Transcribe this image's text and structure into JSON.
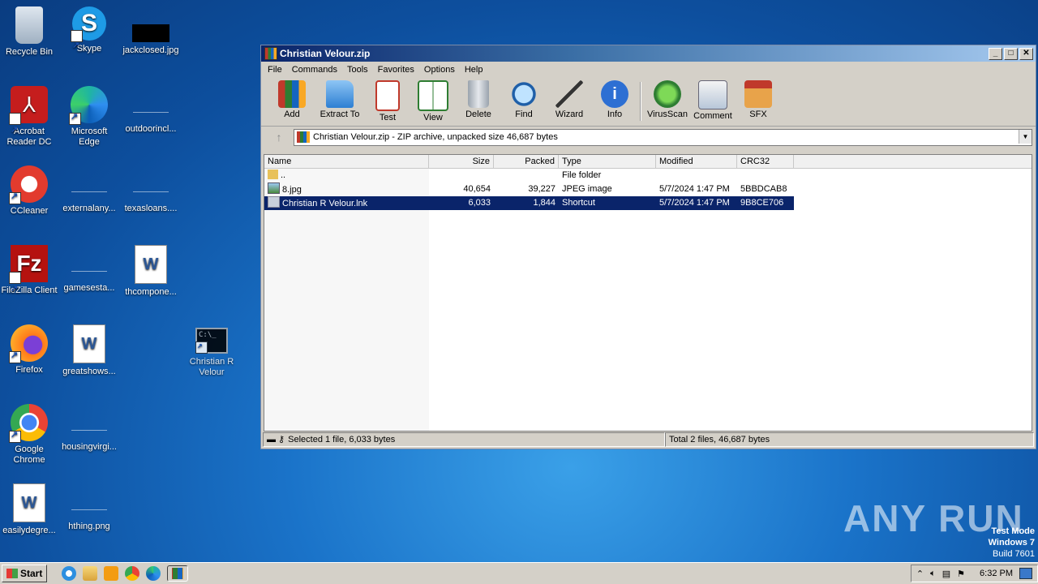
{
  "desktop": {
    "icons": [
      {
        "label": "Recycle Bin"
      },
      {
        "label": "Skype"
      },
      {
        "label": "jackclosed.jpg"
      },
      {
        "label": "Acrobat Reader DC"
      },
      {
        "label": "Microsoft Edge"
      },
      {
        "label": "outdoorincl..."
      },
      {
        "label": "CCleaner"
      },
      {
        "label": "externalany..."
      },
      {
        "label": "texasloans...."
      },
      {
        "label": "FileZilla Client"
      },
      {
        "label": "gamesesta..."
      },
      {
        "label": "thcompone..."
      },
      {
        "label": "Firefox"
      },
      {
        "label": "greatshows..."
      },
      {
        "label": "Christian R Velour"
      },
      {
        "label": "Google Chrome"
      },
      {
        "label": "housingvirgi..."
      },
      {
        "label": "easilydegre..."
      },
      {
        "label": "hthing.png"
      }
    ]
  },
  "window": {
    "title": "Christian Velour.zip",
    "menu": [
      "File",
      "Commands",
      "Tools",
      "Favorites",
      "Options",
      "Help"
    ],
    "toolbar": [
      "Add",
      "Extract To",
      "Test",
      "View",
      "Delete",
      "Find",
      "Wizard",
      "Info",
      "VirusScan",
      "Comment",
      "SFX"
    ],
    "address": "Christian Velour.zip - ZIP archive, unpacked size 46,687 bytes",
    "columns": [
      "Name",
      "Size",
      "Packed",
      "Type",
      "Modified",
      "CRC32"
    ],
    "rows": [
      {
        "name": "..",
        "size": "",
        "packed": "",
        "type": "File folder",
        "modified": "",
        "crc": ""
      },
      {
        "name": "8.jpg",
        "size": "40,654",
        "packed": "39,227",
        "type": "JPEG image",
        "modified": "5/7/2024 1:47 PM",
        "crc": "5BBDCAB8"
      },
      {
        "name": "Christian R Velour.lnk",
        "size": "6,033",
        "packed": "1,844",
        "type": "Shortcut",
        "modified": "5/7/2024 1:47 PM",
        "crc": "9B8CE706"
      }
    ],
    "status_left": "Selected 1 file, 6,033 bytes",
    "status_right": "Total 2 files, 46,687 bytes"
  },
  "taskbar": {
    "start": "Start",
    "clock": "6:32 PM"
  },
  "watermark": {
    "line1": "Test Mode",
    "line2": "Windows 7",
    "line3": "Build 7601",
    "brand": "ANY RUN"
  }
}
